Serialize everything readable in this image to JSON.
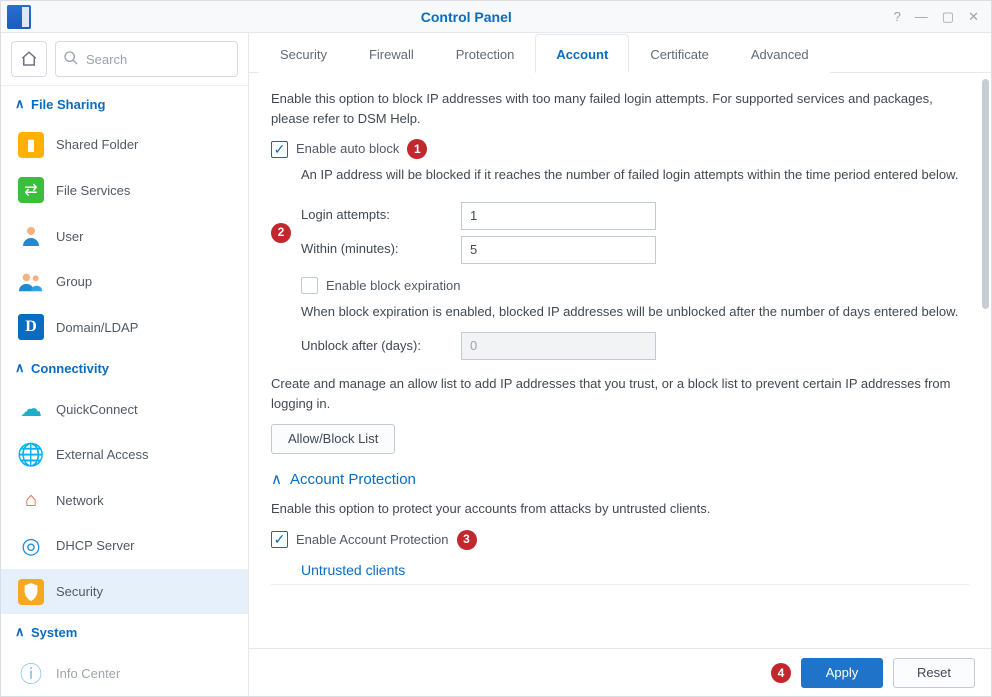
{
  "window": {
    "title": "Control Panel"
  },
  "search": {
    "placeholder": "Search"
  },
  "sidebar": {
    "groups": [
      {
        "label": "File Sharing",
        "items": [
          {
            "label": "Shared Folder"
          },
          {
            "label": "File Services"
          },
          {
            "label": "User"
          },
          {
            "label": "Group"
          },
          {
            "label": "Domain/LDAP"
          }
        ]
      },
      {
        "label": "Connectivity",
        "items": [
          {
            "label": "QuickConnect"
          },
          {
            "label": "External Access"
          },
          {
            "label": "Network"
          },
          {
            "label": "DHCP Server"
          },
          {
            "label": "Security"
          }
        ]
      },
      {
        "label": "System",
        "items": [
          {
            "label": "Info Center"
          }
        ]
      }
    ]
  },
  "tabs": [
    "Security",
    "Firewall",
    "Protection",
    "Account",
    "Certificate",
    "Advanced"
  ],
  "active_tab": "Account",
  "content": {
    "intro": "Enable this option to block IP addresses with too many failed login attempts. For supported services and packages, please refer to DSM Help.",
    "enable_auto_block": "Enable auto block",
    "auto_block_desc": "An IP address will be blocked if it reaches the number of failed login attempts within the time period entered below.",
    "login_attempts_label": "Login attempts:",
    "login_attempts_value": "1",
    "within_label": "Within (minutes):",
    "within_value": "5",
    "enable_block_exp": "Enable block expiration",
    "block_exp_desc": "When block expiration is enabled, blocked IP addresses will be unblocked after the number of days entered below.",
    "unblock_label": "Unblock after (days):",
    "unblock_value": "0",
    "allow_block_desc": "Create and manage an allow list to add IP addresses that you trust, or a block list to prevent certain IP addresses from logging in.",
    "allow_block_btn": "Allow/Block List",
    "acct_prot_head": "Account Protection",
    "acct_prot_desc": "Enable this option to protect your accounts from attacks by untrusted clients.",
    "enable_acct_prot": "Enable Account Protection",
    "untrusted_head": "Untrusted clients"
  },
  "badges": {
    "b1": "1",
    "b2": "2",
    "b3": "3",
    "b4": "4"
  },
  "footer": {
    "apply": "Apply",
    "reset": "Reset"
  }
}
